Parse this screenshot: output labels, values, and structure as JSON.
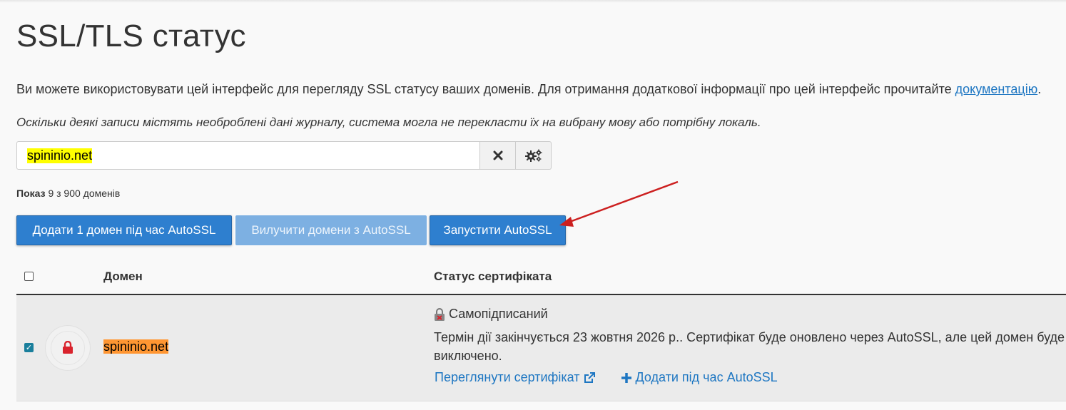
{
  "page": {
    "title": "SSL/TLS статус",
    "description": "Ви можете використовувати цей інтерфейс для перегляду SSL статусу ваших доменів. Для отримання додаткової інформації про цей інтерфейс прочитайте ",
    "doc_link": "документацію",
    "description_end": ".",
    "note": "Оскільки деякі записи містять необроблені дані журналу, система могла не перекласти їх на вибрану мову або потрібну локаль."
  },
  "search": {
    "value": "spininio.net",
    "clear_icon": "close-icon",
    "settings_icon": "gears-icon"
  },
  "count": {
    "label": "Показ",
    "text": "9 з 900 доменів"
  },
  "actions": {
    "add_button": "Додати 1 домен під час AutoSSL",
    "exclude_button": "Вилучити домени з AutoSSL",
    "run_button": "Запустити AutoSSL"
  },
  "table": {
    "headers": {
      "domain": "Домен",
      "status": "Статус сертифіката"
    },
    "rows": [
      {
        "checked": true,
        "domain": "spininio.net",
        "status_title": "Самопідписаний",
        "status_line1": "Термін дії закінчується 23 жовтня 2026 р.. Сертифікат буде оновлено через AutoSSL, але цей домен буде",
        "status_line2": "виключено.",
        "view_link": "Переглянути сертифікат",
        "add_link": "Додати під час AutoSSL"
      }
    ]
  },
  "colors": {
    "primary": "#2e7fcf",
    "disabled": "#7db0e2",
    "link": "#1d76c2",
    "search_highlight": "#ffff00",
    "row_highlight": "#ff9632",
    "lock_red": "#d9232d",
    "arrow_red": "#cc1f1f"
  }
}
